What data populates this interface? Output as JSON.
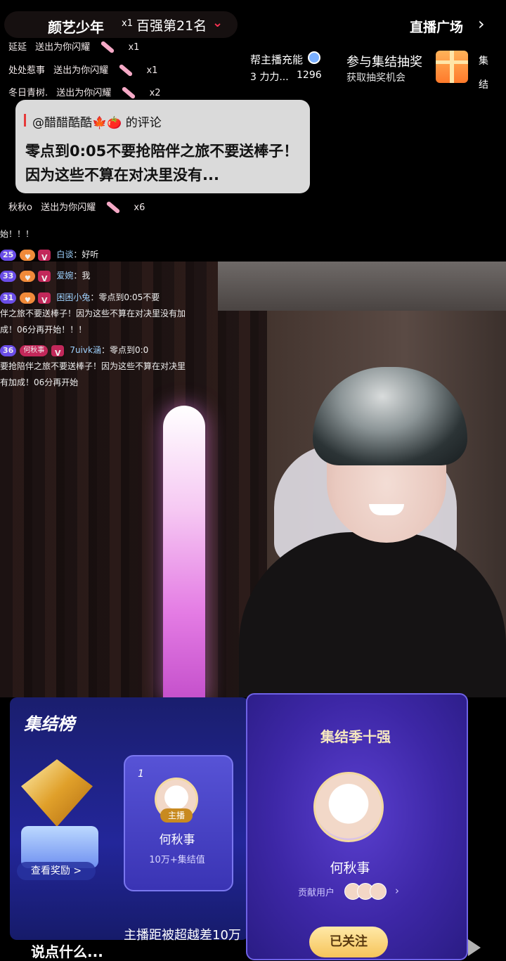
{
  "header": {
    "anchor_name": "颜艺少年",
    "x1": "x1",
    "rank": "百强第21名",
    "plaza": "直播广场",
    "help_title": "帮主播充能",
    "help_sub": "3 力力...",
    "help_num": "1296",
    "lottery_title": "参与集结抽奖",
    "lottery_sub": "获取抽奖机会",
    "gather_chars": [
      "集",
      "结"
    ]
  },
  "gifts": [
    {
      "user": "延延",
      "action": "送出为你闪耀",
      "count": "x1"
    },
    {
      "user": "延延",
      "action": "送出为你闪耀",
      "count": "x1"
    },
    {
      "user": "处处惹事",
      "action": "送出为你闪耀",
      "count": "x1"
    },
    {
      "user": "冬日青树.",
      "action": "送出为你闪耀",
      "count": "x2"
    },
    {
      "user": "秋秋o",
      "action": "送出为你闪耀",
      "count": "x6"
    }
  ],
  "popup": {
    "who": "@醋醋酷酷🍁🍅 的评论",
    "text": "零点到0:05不要抢陪伴之旅不要送棒子！因为这些不算在对决里没有..."
  },
  "chat": {
    "fragment": "始！！！",
    "messages": [
      {
        "level": "25",
        "badge": "V",
        "user": "白谈",
        "text": "：好听"
      },
      {
        "level": "33",
        "badge": "V",
        "user": "爱婉",
        "text": "：我"
      },
      {
        "level": "31",
        "badge": "V",
        "user": "困困小兔",
        "text": "：零点到0:05不要",
        "cont": [
          "伴之旅不要送棒子！因为这些不算在对决里没有加",
          "成！06分再开始！！！"
        ]
      },
      {
        "level": "36",
        "fan": "何秋事",
        "badge": "V",
        "user": "7uivk涵",
        "text": "：零点到0:0",
        "cont": [
          "要抢陪伴之旅不要送棒子！因为这些不算在对决里",
          "有加成！06分再开始"
        ]
      }
    ]
  },
  "board": {
    "title": "集结榜",
    "view_reward": "查看奖励 >",
    "card_rank": "1",
    "host_badge": "主播",
    "card_name": "何秋事",
    "card_value": "10万+集结值",
    "gap_text": "主播距被超越差10万"
  },
  "top10": {
    "title": "集结季十强",
    "name": "何秋事",
    "contrib": "贡献用户",
    "follow": "已关注"
  },
  "input": {
    "placeholder": "说点什么..."
  },
  "colors": {
    "accent": "#ff3355",
    "panel": "#23269a",
    "gold": "#f6c45a"
  }
}
